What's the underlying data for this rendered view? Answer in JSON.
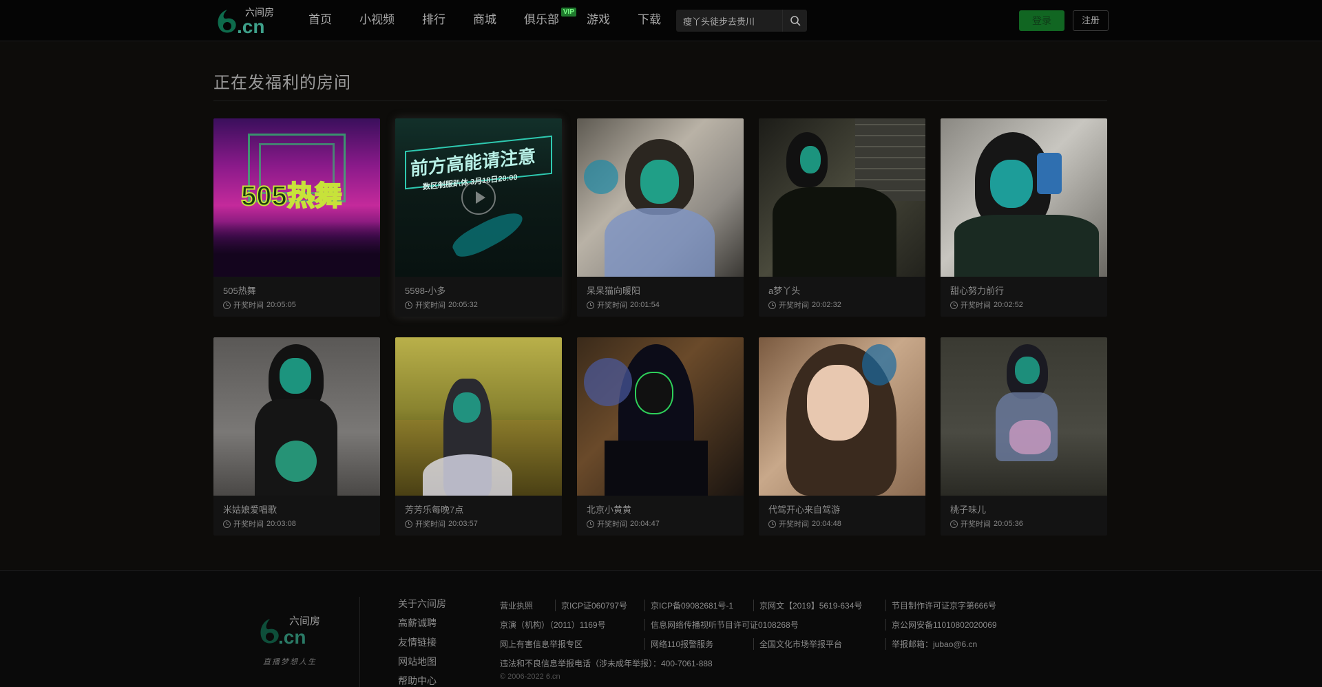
{
  "header": {
    "logo_text": "六间房",
    "logo_domain": ".cn",
    "nav": [
      "首页",
      "小视频",
      "排行",
      "商城",
      "俱乐部",
      "游戏",
      "下载"
    ],
    "vip_badge": "VIP",
    "search_value": "瘦丫头徒步去贵川",
    "login_label": "登录",
    "register_label": "注册"
  },
  "main": {
    "section_title": "正在发福利的房间",
    "time_label": "开奖时间",
    "rooms": [
      {
        "name": "505热舞",
        "time": "20:05:05",
        "poster": "505热舞"
      },
      {
        "name": "5598-小多",
        "time": "20:05:32",
        "poster": "前方高能请注意",
        "poster_sub": "数区制服趴体 3月18日20:00"
      },
      {
        "name": "呆呆猫向暖阳",
        "time": "20:01:54"
      },
      {
        "name": "a梦丫头",
        "time": "20:02:32"
      },
      {
        "name": "甜心努力前行",
        "time": "20:02:52"
      },
      {
        "name": "米姑娘爱唱歌",
        "time": "20:03:08"
      },
      {
        "name": "芳芳乐每晚7点",
        "time": "20:03:57"
      },
      {
        "name": "北京小黄黄",
        "time": "20:04:47"
      },
      {
        "name": "代驾开心来自驾游",
        "time": "20:04:48"
      },
      {
        "name": "桃子味儿",
        "time": "20:05:36"
      }
    ]
  },
  "footer": {
    "logo_text": "六间房",
    "logo_domain": ".cn",
    "slogan": "直播梦想人生",
    "links": [
      "关于六间房",
      "高薪诚聘",
      "友情链接",
      "网站地图",
      "帮助中心"
    ],
    "info_rows": [
      [
        "营业执照",
        "京ICP证060797号",
        "京ICP备09082681号-1",
        "京网文【2019】5619-634号",
        "节目制作许可证京字第666号"
      ],
      [
        "京演（机构）（2011）1169号",
        "信息网络传播视听节目许可证0108268号",
        "京公网安备11010802020069"
      ],
      [
        "网上有害信息举报专区",
        "网络110报警服务",
        "全国文化市场举报平台",
        "举报邮箱：jubao@6.cn"
      ],
      [
        "违法和不良信息举报电话（涉未成年举报）：400-7061-888"
      ]
    ],
    "copyright": "© 2006-2022 6.cn"
  },
  "colors": {
    "background": "#0d0c0a",
    "header_bg": "#050505",
    "accent_green": "#116622",
    "card_bg": "#131313"
  },
  "icons": [
    "search-icon",
    "clock-icon",
    "play-icon",
    "logo-mark"
  ]
}
